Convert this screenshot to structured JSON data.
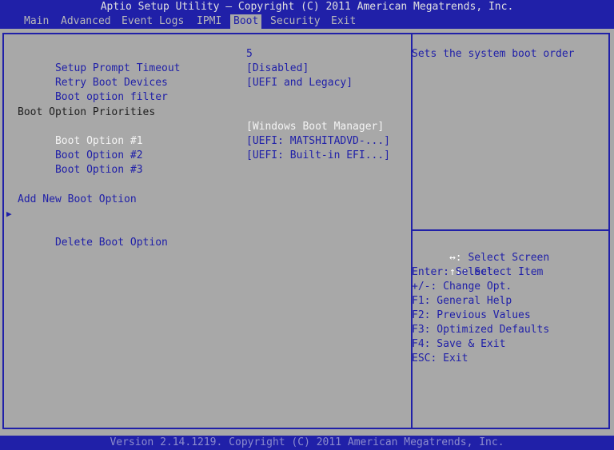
{
  "title": "Aptio Setup Utility – Copyright (C) 2011 American Megatrends, Inc.",
  "tabs": [
    {
      "label": "Main"
    },
    {
      "label": "Advanced"
    },
    {
      "label": "Event Logs"
    },
    {
      "label": "IPMI"
    },
    {
      "label": "Boot",
      "active": true
    },
    {
      "label": "Security"
    },
    {
      "label": "Exit"
    }
  ],
  "settings": [
    {
      "label": "Setup Prompt Timeout",
      "value": "5"
    },
    {
      "label": "Retry Boot Devices",
      "value": "[Disabled]"
    },
    {
      "label": "Boot option filter",
      "value": "[UEFI and Legacy]"
    }
  ],
  "priorities_heading": "Boot Option Priorities",
  "boot_options": [
    {
      "label": "Boot Option #1",
      "value": "[Windows Boot Manager]"
    },
    {
      "label": "Boot Option #2",
      "value": "[UEFI: MATSHITADVD-...]"
    },
    {
      "label": "Boot Option #3",
      "value": "[UEFI: Built-in EFI...]"
    }
  ],
  "actions": [
    {
      "label": "Add New Boot Option"
    },
    {
      "label": "Delete Boot Option"
    }
  ],
  "selection_arrow": "▶",
  "help": "Sets the system boot order",
  "keys": [
    {
      "key": "↔:",
      "desc": " Select Screen"
    },
    {
      "key": "↑↓:",
      "desc": " Select Item"
    },
    {
      "key": "",
      "desc": "Enter: Select"
    },
    {
      "key": "",
      "desc": "+/-: Change Opt."
    },
    {
      "key": "",
      "desc": "F1: General Help"
    },
    {
      "key": "",
      "desc": "F2: Previous Values"
    },
    {
      "key": "",
      "desc": "F3: Optimized Defaults"
    },
    {
      "key": "",
      "desc": "F4: Save & Exit"
    },
    {
      "key": "",
      "desc": "ESC: Exit"
    }
  ],
  "footer": "Version 2.14.1219. Copyright (C) 2011 American Megatrends, Inc.",
  "colors": {
    "background_blue": "#2020a8",
    "panel_gray": "#a8a8a8",
    "highlight_white": "#f4f4f4"
  }
}
